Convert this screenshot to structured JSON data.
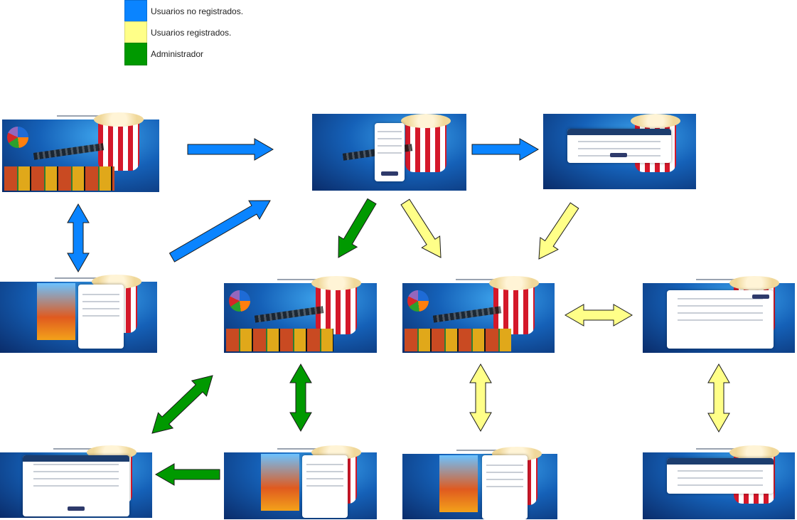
{
  "legend": [
    {
      "label": "Usuarios no registrados.",
      "color": "#0a84ff"
    },
    {
      "label": "Usuarios registrados.",
      "color": "#ffff88"
    },
    {
      "label": "Administrador",
      "color": "#009900"
    }
  ],
  "arrow_colors": {
    "blue": "#0a84ff",
    "yellow": "#ffff88",
    "green": "#009900"
  },
  "screens": [
    "home-guest",
    "login",
    "register",
    "movie-detail-guest",
    "home-admin",
    "home-user",
    "profile",
    "add-movie-form",
    "movie-detail-admin",
    "movie-detail-user",
    "edit-profile"
  ]
}
